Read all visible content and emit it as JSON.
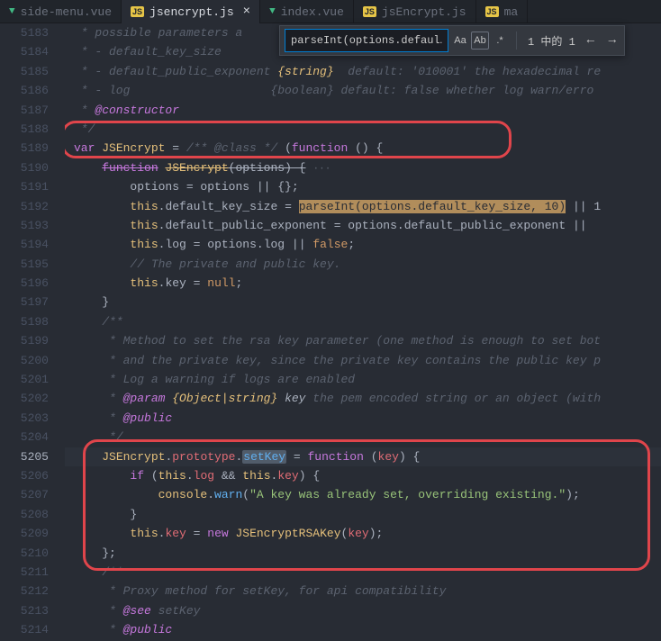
{
  "tabs": [
    {
      "icon": "vue",
      "label": "side-menu.vue",
      "active": false,
      "dirty": false
    },
    {
      "icon": "js",
      "label": "jsencrypt.js",
      "active": true,
      "dirty": false
    },
    {
      "icon": "vue",
      "label": "index.vue",
      "active": false,
      "dirty": false
    },
    {
      "icon": "js",
      "label": "jsEncrypt.js",
      "active": false,
      "dirty": false
    },
    {
      "icon": "js",
      "label": "ma",
      "active": false,
      "dirty": false
    }
  ],
  "find": {
    "query": "parseInt(options.defaul…",
    "opt_case": "Aa",
    "opt_word": "Ab",
    "opt_regex": ".*",
    "count": "1 中的 1",
    "prev": "←",
    "next": "→"
  },
  "gutter": {
    "start": 5183,
    "end": 5214,
    "current": 5205
  },
  "code": {
    "c5183": " * possible parameters a",
    "c5184_a": " * - default_key_size",
    "c5185_a": " * - default_public_exponent ",
    "c5185_b": "{string}",
    "c5185_c": "  default: '010001' the hexadecimal re",
    "c5186_a": " * - log                    {boolean} default: false whether log warn/erro",
    "c5187_a": " * ",
    "c5187_b": "@constructor",
    "c5188": " */",
    "c5189_var": "var",
    "c5189_name": "JSEncrypt",
    "c5189_eq": " = ",
    "c5189_cm": "/** @class */",
    "c5189_paren": " (",
    "c5189_fn": "function",
    "c5189_rest": " () {",
    "c5190_fn": "function",
    "c5190_name": "JSEncrypt",
    "c5190_p": "(options) {",
    "c5190_dots": "···",
    "c5191_a": "options = options || {};",
    "c5192_this": "this",
    "c5192_a": ".",
    "c5192_prop": "default_key_size",
    "c5192_eq": " = ",
    "c5192_match": "parseInt(options.default_key_size, 10)",
    "c5192_or": " || 1",
    "c5193_this": "this",
    "c5193_a": ".",
    "c5193_prop": "default_public_exponent",
    "c5193_eq": " = options.",
    "c5193_prop2": "default_public_exponent",
    "c5193_or": " || ",
    "c5194_this": "this",
    "c5194_a": ".",
    "c5194_prop": "log",
    "c5194_eq": " = options.",
    "c5194_prop2": "log",
    "c5194_or": " || ",
    "c5194_false": "false",
    "c5194_semi": ";",
    "c5195": "// The private and public key.",
    "c5196_this": "this",
    "c5196_a": ".",
    "c5196_prop": "key",
    "c5196_eq": " = ",
    "c5196_null": "null",
    "c5196_semi": ";",
    "c5197": "}",
    "c5198": "/**",
    "c5199": " * Method to set the rsa key parameter (one method is enough to set bot",
    "c5200": " * and the private key, since the private key contains the public key p",
    "c5201": " * Log a warning if logs are enabled",
    "c5202_a": " * ",
    "c5202_tag": "@param",
    "c5202_type": " {Object|string}",
    "c5202_name": " key",
    "c5202_rest": " the pem encoded string or an object (with",
    "c5203_a": " * ",
    "c5203_tag": "@public",
    "c5204": " */",
    "c5205_cls": "JSEncrypt",
    "c5205_a": ".",
    "c5205_proto": "prototype",
    "c5205_b": ".",
    "c5205_met": "setKey",
    "c5205_eq": " = ",
    "c5205_fn": "function",
    "c5205_p": " (",
    "c5205_arg": "key",
    "c5205_rest": ") {",
    "c5206_if": "if",
    "c5206_p": " (",
    "c5206_this1": "this",
    "c5206_a": ".",
    "c5206_log": "log",
    "c5206_and": " && ",
    "c5206_this2": "this",
    "c5206_b": ".",
    "c5206_key": "key",
    "c5206_rest": ") {",
    "c5207_cons": "console",
    "c5207_a": ".",
    "c5207_warn": "warn",
    "c5207_p": "(",
    "c5207_str": "\"A key was already set, overriding existing.\"",
    "c5207_rest": ");",
    "c5208": "}",
    "c5209_this": "this",
    "c5209_a": ".",
    "c5209_prop": "key",
    "c5209_eq": " = ",
    "c5209_new": "new",
    "c5209_cls": " JSEncryptRSAKey",
    "c5209_p": "(",
    "c5209_arg": "key",
    "c5209_rest": ");",
    "c5210": "};",
    "c5211": "/**",
    "c5212": " * Proxy method for setKey, for api compatibility",
    "c5213_a": " * ",
    "c5213_tag": "@see",
    "c5213_b": " setKey",
    "c5214_a": " * ",
    "c5214_tag": "@public"
  }
}
